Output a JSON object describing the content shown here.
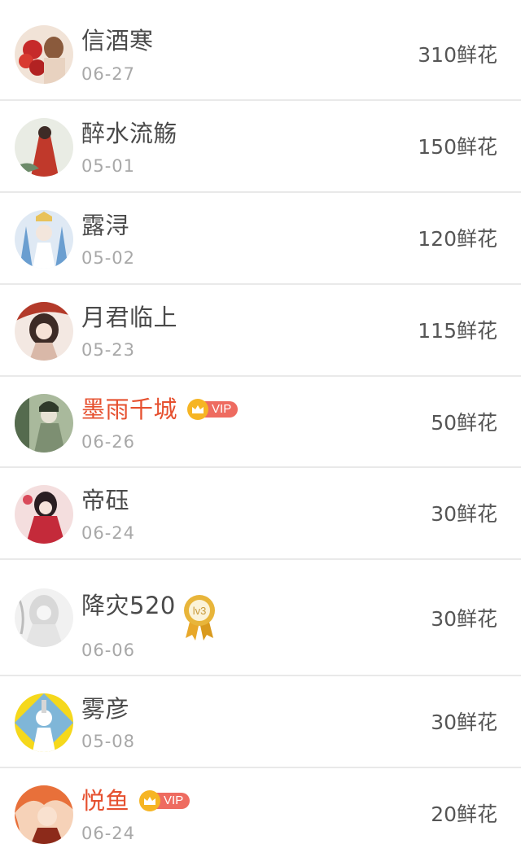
{
  "supporters": [
    {
      "name": "信酒寒",
      "date": "06-27",
      "flowers": "310鲜花",
      "vip": false,
      "badge": null,
      "avatar_colors": [
        "#c62a2a",
        "#f1e3d7",
        "#8a5a3c"
      ]
    },
    {
      "name": "醉水流觞",
      "date": "05-01",
      "flowers": "150鲜花",
      "vip": false,
      "badge": null,
      "avatar_colors": [
        "#e9ece4",
        "#c0392b",
        "#6d8b6a"
      ]
    },
    {
      "name": "露浔",
      "date": "05-02",
      "flowers": "120鲜花",
      "vip": false,
      "badge": null,
      "avatar_colors": [
        "#dfe9f4",
        "#6a9ed0",
        "#e8c25a"
      ]
    },
    {
      "name": "月君临上",
      "date": "05-23",
      "flowers": "115鲜花",
      "vip": false,
      "badge": null,
      "avatar_colors": [
        "#f3e8e2",
        "#b33a2a",
        "#3d2b26"
      ]
    },
    {
      "name": "墨雨千城",
      "date": "06-26",
      "flowers": "50鲜花",
      "vip": true,
      "vip_label": "VIP",
      "badge": null,
      "avatar_colors": [
        "#a9b99c",
        "#556b4e",
        "#e7e2d4"
      ]
    },
    {
      "name": "帝砡",
      "date": "06-24",
      "flowers": "30鲜花",
      "vip": false,
      "badge": null,
      "avatar_colors": [
        "#f4dede",
        "#c42a3a",
        "#2a1e22"
      ]
    },
    {
      "name": "降灾520",
      "date": "06-06",
      "flowers": "30鲜花",
      "vip": false,
      "badge": "lv3",
      "avatar_colors": [
        "#f1f1f1",
        "#d8d8d8",
        "#bcbcbc"
      ]
    },
    {
      "name": "雾彦",
      "date": "05-08",
      "flowers": "30鲜花",
      "vip": false,
      "badge": null,
      "avatar_colors": [
        "#f5d81c",
        "#7fb6d8",
        "#ffffff"
      ]
    },
    {
      "name": "悦鱼",
      "date": "06-24",
      "flowers": "20鲜花",
      "vip": true,
      "vip_label": "VIP",
      "badge": null,
      "avatar_colors": [
        "#e8703a",
        "#f6d2b8",
        "#8c2a1a"
      ]
    }
  ],
  "colors": {
    "vip_name": "#e6502f",
    "vip_badge": "#ee6b60",
    "crown": "#f6b524",
    "medal": "#e8b53a"
  }
}
